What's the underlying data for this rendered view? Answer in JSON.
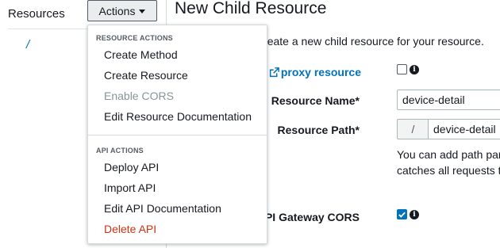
{
  "left_panel": {
    "heading": "Resources",
    "root_path": "/"
  },
  "actions_button": {
    "label": "Actions"
  },
  "main": {
    "title": "New Child Resource",
    "intro": "Use this page to create a new child resource for your resource.",
    "proxy_label": "proxy resource",
    "resource_name_label": "Resource Name*",
    "resource_name_value": "device-detail",
    "resource_path_label": "Resource Path*",
    "resource_path_prefix": "/",
    "resource_path_value": "device-detail",
    "help_text_line1": "You can add path parameters using brackets. For example, the resource path {username} represents a path parameter called 'username'. Configuring /{proxy+} as a proxy resource",
    "help_text_line2": "catches all requests to its sub-resources.",
    "cors_label": "Enable API Gateway CORS",
    "cors_checked": true
  },
  "dropdown": {
    "resource_actions_header": "RESOURCE ACTIONS",
    "resource_items": [
      {
        "label": "Create Method"
      },
      {
        "label": "Create Resource"
      },
      {
        "label": "Enable CORS"
      },
      {
        "label": "Edit Resource Documentation"
      }
    ],
    "api_actions_header": "API ACTIONS",
    "api_items": [
      {
        "label": "Deploy API"
      },
      {
        "label": "Import API"
      },
      {
        "label": "Edit API Documentation"
      },
      {
        "label": "Delete API"
      }
    ]
  },
  "colors": {
    "link": "#0073bb",
    "danger": "#d13212",
    "disabled": "#879596"
  }
}
